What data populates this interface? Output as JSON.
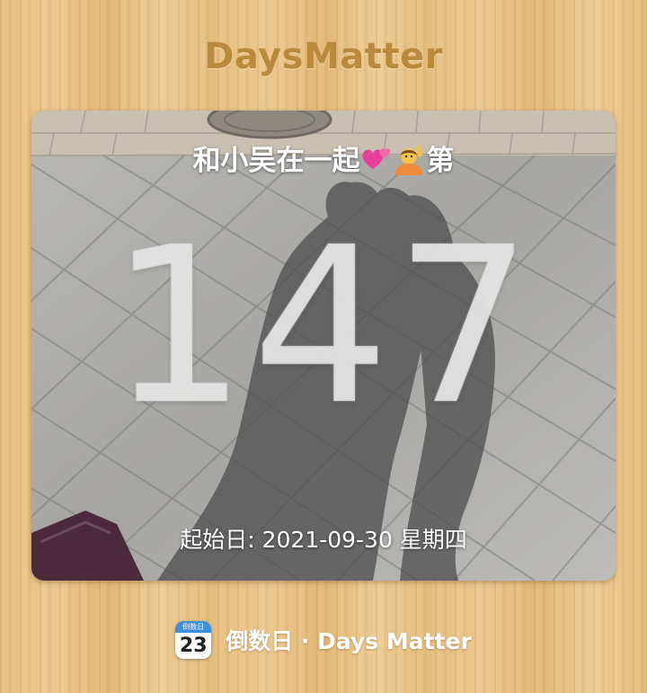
{
  "app": {
    "title": "DaysMatter"
  },
  "card": {
    "title": "和小吴在一起",
    "title_suffix": "第",
    "title_emojis": [
      "two-hearts-icon",
      "person-raising-hand-icon"
    ],
    "day_count": "147",
    "start_date_label": "起始日: 2021-09-30 星期四"
  },
  "footer": {
    "icon_header": "倒数日",
    "icon_number": "23",
    "label": "倒数日 · Days Matter"
  },
  "colors": {
    "title_gold": "#b98a3e",
    "wood": "#e8c288",
    "icon_blue": "#3d8fd8"
  }
}
